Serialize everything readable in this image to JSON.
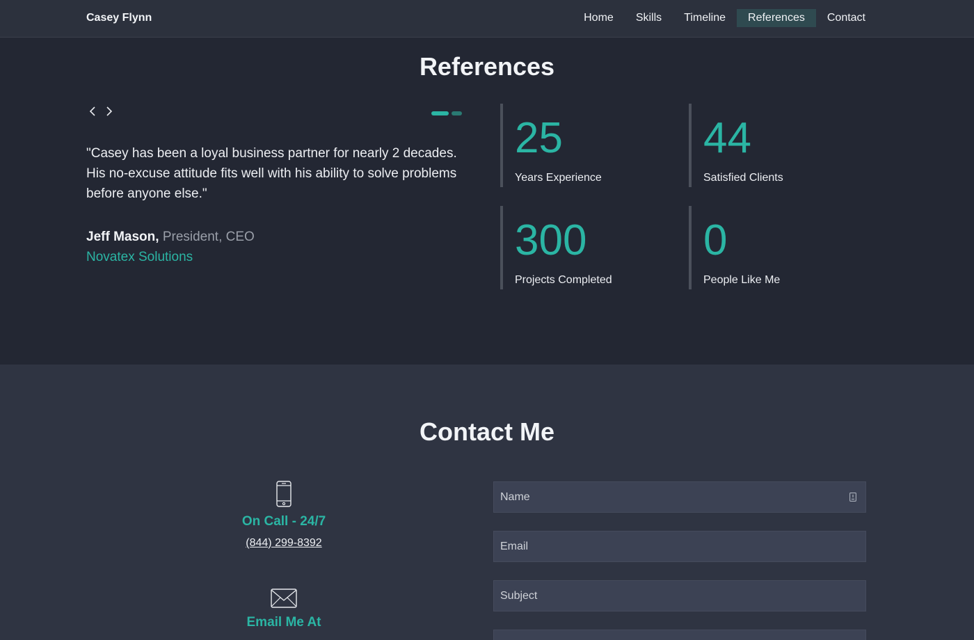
{
  "header": {
    "brand": "Casey Flynn",
    "nav": [
      {
        "label": "Home",
        "active": false
      },
      {
        "label": "Skills",
        "active": false
      },
      {
        "label": "Timeline",
        "active": false
      },
      {
        "label": "References",
        "active": true
      },
      {
        "label": "Contact",
        "active": false
      }
    ]
  },
  "references": {
    "title": "References",
    "carousel": {
      "slides": 2,
      "current": 1
    },
    "quote": "\"Casey has been a loyal business partner for nearly 2 decades. His no-excuse attitude fits well with his ability to solve problems before anyone else.\"",
    "author_name": "Jeff Mason,",
    "author_role": "President, CEO",
    "author_company": "Novatex Solutions",
    "stats": [
      {
        "value": "25",
        "label": "Years Experience"
      },
      {
        "value": "44",
        "label": "Satisfied Clients"
      },
      {
        "value": "300",
        "label": "Projects Completed"
      },
      {
        "value": "0",
        "label": "People Like Me"
      }
    ]
  },
  "contact": {
    "title": "Contact Me",
    "phone_heading": "On Call - 24/7",
    "phone_number": "(844) 299-8392",
    "email_heading": "Email Me At",
    "form": {
      "name_placeholder": "Name",
      "email_placeholder": "Email",
      "subject_placeholder": "Subject"
    }
  },
  "colors": {
    "accent": "#2bb5a4",
    "background": "#232733",
    "contact_background": "#2f3442",
    "nav_active": "#2f4a50"
  }
}
